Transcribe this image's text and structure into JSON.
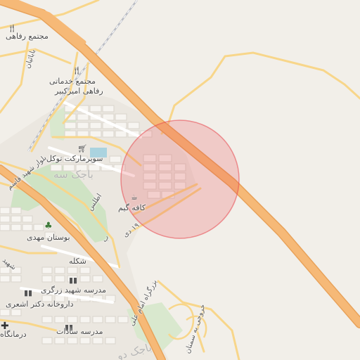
{
  "map": {
    "highlight_color": "#e8474f",
    "labels": {
      "mojtama_refahi": "مجتمع رفاهی",
      "mojtama_khadamati": "مجتمع خدماتی",
      "refahi_amirkabir": "رفاهی امیرکبیر",
      "babaian": "بابائیان",
      "supermarket": "سوپرمارکت توکل",
      "bajak_se": "باجک سه",
      "atlas": "اطلس",
      "cafe_name": "کافه گیم",
      "dey": "۱۹ دی",
      "shahid_ghasem": "بلوار شهید قاسم",
      "bustan_mahdi": "بوستان مهدی",
      "shekle": "شکله",
      "madrese_zargari": "مدرسه شهید زرگری",
      "darookhane": "داروخانه دکتر اشعری",
      "madrese_sadat": "مدرسه سادات",
      "darmangah": "درمانگاه",
      "imam_ali": "بزرگراه امام علی",
      "khorooji": "خروجی به سمنان",
      "bajak_do": "باجک دو",
      "partial_b": "ب",
      "partial_shahid": "شهید"
    },
    "icons": {
      "restaurant": "fork-knife-icon",
      "cafe": "coffee-cup-icon",
      "shop": "shopping-cart-icon",
      "park": "tree-icon",
      "school": "school-icon",
      "clinic": "cross-icon"
    }
  }
}
